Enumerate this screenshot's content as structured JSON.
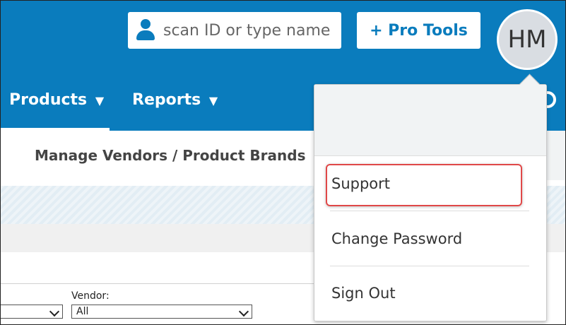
{
  "header": {
    "search_placeholder": "scan ID or type name",
    "pro_tools_label": "+ Pro Tools",
    "avatar_initials": "HM",
    "accent_color": "#0a7cbd"
  },
  "nav": {
    "items": [
      {
        "label": "Products",
        "caret": "▼"
      },
      {
        "label": "Reports",
        "caret": "▼"
      }
    ]
  },
  "subnav": {
    "active_label": "Manage Vendors / Product Brands"
  },
  "filters": {
    "vendor_label": "Vendor:",
    "vendor_value": "All"
  },
  "user_menu": {
    "items": [
      {
        "label": "Support"
      },
      {
        "label": "Change Password"
      },
      {
        "label": "Sign Out"
      }
    ],
    "highlight_color": "#e04848"
  }
}
